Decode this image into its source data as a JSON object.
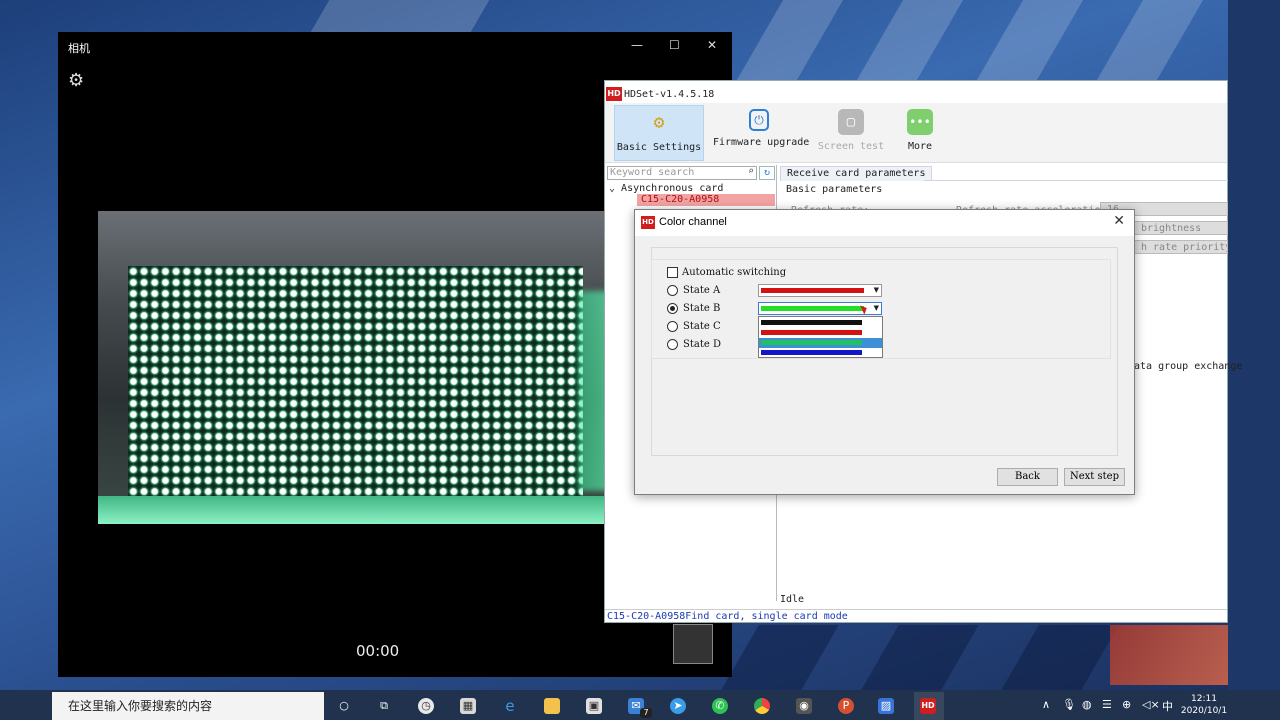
{
  "camera": {
    "title": "相机",
    "timer": "00:00",
    "controls": {
      "minimize": "—",
      "maximize": "☐",
      "close": "✕"
    },
    "settings_icon": "gear-icon"
  },
  "hdset": {
    "title": "HDSet-v1.4.5.18",
    "logo": "HD",
    "toolbar": [
      {
        "label": "Basic Settings",
        "icon": "gear-icon",
        "color": "#d6a21e",
        "active": true
      },
      {
        "label": "Firmware upgrade",
        "icon": "chip-icon",
        "color": "#2f7fd6",
        "active": false
      },
      {
        "label": "Screen test",
        "icon": "screen-icon",
        "color": "#a0a0a0",
        "active": false
      },
      {
        "label": "More",
        "icon": "more-icon",
        "color": "#7fcf6e",
        "active": false
      }
    ],
    "search_placeholder": "Keyword search",
    "tree_root": "Asynchronous card",
    "tree_child": "C15-C20-A0958",
    "tab": "Receive card parameters",
    "section": "Basic parameters",
    "ghost": {
      "refresh_rate": "Refresh rate:",
      "refresh_accel": "Refresh rate acceleration:",
      "refresh_accel_value": "16",
      "brightness": "brightness",
      "rate_priority": "h rate priority",
      "data_group": "ata group exchange"
    },
    "idle": "Idle",
    "status": "C15-C20-A0958Find card, single card mode"
  },
  "dialog": {
    "title": "Color channel",
    "auto_switch": "Automatic switching",
    "states": [
      {
        "label": "State A",
        "selected": false,
        "color": "#d41010"
      },
      {
        "label": "State B",
        "selected": true,
        "color": "#22e022"
      },
      {
        "label": "State C",
        "selected": false,
        "color": ""
      },
      {
        "label": "State D",
        "selected": false,
        "color": ""
      }
    ],
    "dropdown_options": [
      {
        "color": "#111111",
        "selected": false
      },
      {
        "color": "#d41010",
        "selected": false
      },
      {
        "color": "#22e022",
        "selected": true
      },
      {
        "color": "#1515c8",
        "selected": false
      }
    ],
    "back": "Back",
    "next": "Next step"
  },
  "taskbar": {
    "search_placeholder": "在这里输入你要搜索的内容",
    "time": "12:11",
    "date": "2020/10/1",
    "ime": "中",
    "apps": [
      "cortana-icon",
      "task-view-icon",
      "clock-app-icon",
      "calculator-icon",
      "edge-icon",
      "explorer-icon",
      "store-icon",
      "mail-icon",
      "feedback-icon",
      "wechat-icon",
      "chrome-icon",
      "camera-icon",
      "powerpoint-icon",
      "photos-icon",
      "hdset-icon"
    ],
    "mail_badge": "7"
  }
}
